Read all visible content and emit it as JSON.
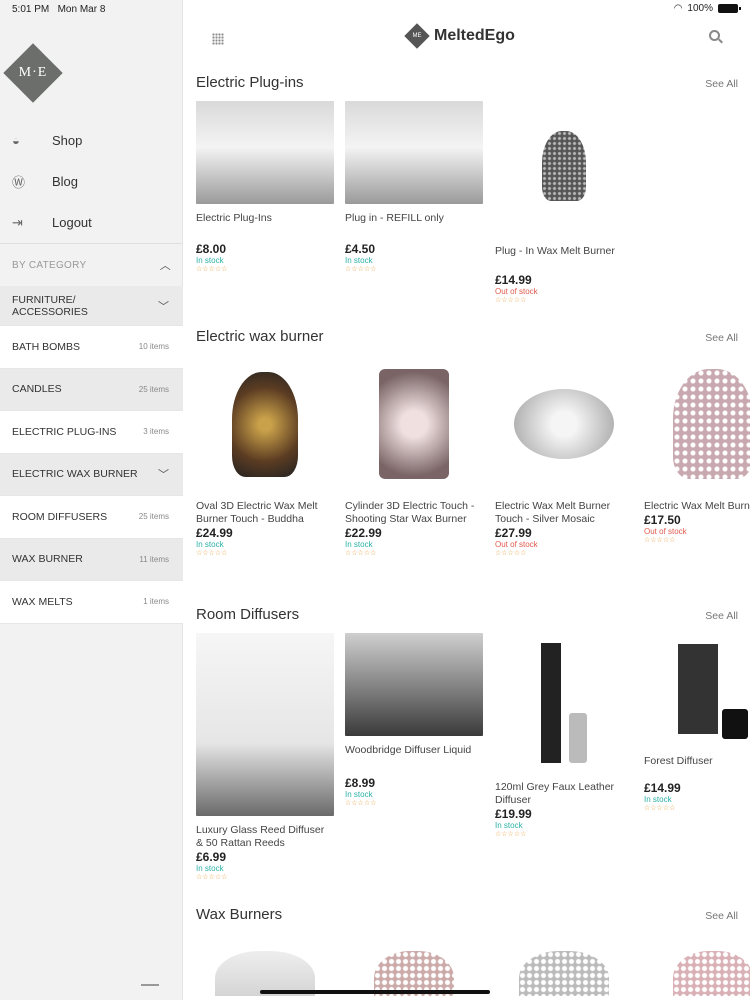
{
  "status": {
    "time": "5:01 PM",
    "date": "Mon Mar 8",
    "battery": "100%"
  },
  "brand": {
    "name": "MeltedEgo",
    "logo_text": "M·E",
    "small_logo_text": "ME"
  },
  "sidebar": {
    "links": [
      {
        "label": "Shop",
        "icon": "basket-icon"
      },
      {
        "label": "Blog",
        "icon": "wordpress-icon"
      },
      {
        "label": "Logout",
        "icon": "logout-icon"
      }
    ],
    "category_heading": "BY CATEGORY",
    "categories": [
      {
        "label": "FURNITURE/ ACCESSORIES",
        "count": ""
      },
      {
        "label": "BATH BOMBS",
        "count": "10 items"
      },
      {
        "label": "CANDLES",
        "count": "25 items"
      },
      {
        "label": "ELECTRIC PLUG-INS",
        "count": "3 items"
      },
      {
        "label": "ELECTRIC WAX BURNER",
        "count": ""
      },
      {
        "label": "ROOM DIFFUSERS",
        "count": "25 items"
      },
      {
        "label": "WAX BURNER",
        "count": "11 items"
      },
      {
        "label": "WAX MELTS",
        "count": "1 items"
      }
    ]
  },
  "see_all": "See All",
  "stars": "☆☆☆☆☆",
  "sections": [
    {
      "title": "Electric Plug-ins",
      "products": [
        {
          "name": "Electric Plug-Ins",
          "price": "£8.00",
          "stock": "In stock"
        },
        {
          "name": "Plug in - REFILL only",
          "price": "£4.50",
          "stock": "In stock"
        },
        {
          "name": "Plug - In Wax Melt Burner",
          "price": "£14.99",
          "stock": "Out of stock"
        }
      ]
    },
    {
      "title": "Electric wax burner",
      "products": [
        {
          "name": "Oval 3D Electric Wax Melt Burner Touch - Buddha",
          "price": "£24.99",
          "stock": "In stock"
        },
        {
          "name": "Cylinder 3D Electric Touch - Shooting Star Wax Burner",
          "price": "£22.99",
          "stock": "In stock"
        },
        {
          "name": "Electric Wax Melt Burner Touch - Silver Mosaic",
          "price": "£27.99",
          "stock": "Out of stock"
        },
        {
          "name": "Electric Wax Melt Burner Touch - Pink Droplet",
          "price": "£17.50",
          "stock": "Out of stock"
        }
      ]
    },
    {
      "title": "Room Diffusers",
      "products": [
        {
          "name": "Luxury Glass Reed Diffuser & 50 Rattan Reeds",
          "price": "£6.99",
          "stock": "In stock"
        },
        {
          "name": "Woodbridge Diffuser Liquid",
          "price": "£8.99",
          "stock": "In stock"
        },
        {
          "name": "120ml Grey Faux Leather Diffuser",
          "price": "£19.99",
          "stock": "In stock"
        },
        {
          "name": "Forest Diffuser",
          "price": "£14.99",
          "stock": "In stock"
        }
      ]
    },
    {
      "title": "Wax Burners"
    }
  ],
  "colors": {
    "in_stock": "#2ab0a6",
    "out_of_stock": "#e05a4c",
    "brand": "#6b6e6a"
  }
}
